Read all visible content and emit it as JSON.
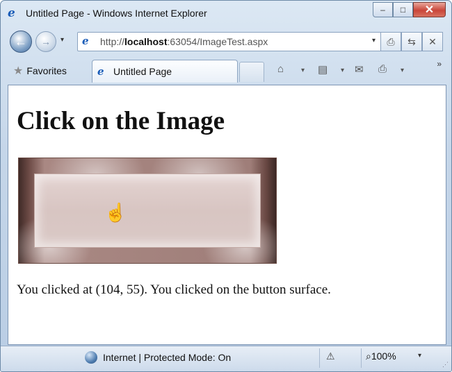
{
  "window": {
    "title": "Untitled Page - Windows Internet Explorer",
    "minimize_symbol": "–",
    "maximize_symbol": "□",
    "close_symbol": "✕"
  },
  "navigation": {
    "back_symbol": "←",
    "forward_symbol": "→",
    "dropdown_symbol": "▾",
    "address_prefix": "http://",
    "address_host": "localhost",
    "address_rest": ":63054/ImageTest.aspx",
    "compat_symbol": "⎙",
    "refresh_symbol": "⇆",
    "stop_symbol": "✕"
  },
  "toolbar": {
    "favorites_label": "Favorites",
    "tab_title": "Untitled Page",
    "home_symbol": "⌂",
    "feeds_symbol": "▤",
    "mail_symbol": "✉",
    "print_symbol": "⎙",
    "more_symbol": "»"
  },
  "page": {
    "heading": "Click on the Image",
    "cursor_symbol": "☝",
    "result_text": "You clicked at (104, 55). You clicked on the button surface."
  },
  "status": {
    "zone_text": "Internet | Protected Mode: On",
    "zone_button_symbol": "⚠",
    "zoom_label": "100%",
    "zoom_symbol": "⌕"
  },
  "colors": {
    "frame": "#c5d6e9",
    "close_button": "#c9463a",
    "link_blue": "#1a5cb8"
  }
}
